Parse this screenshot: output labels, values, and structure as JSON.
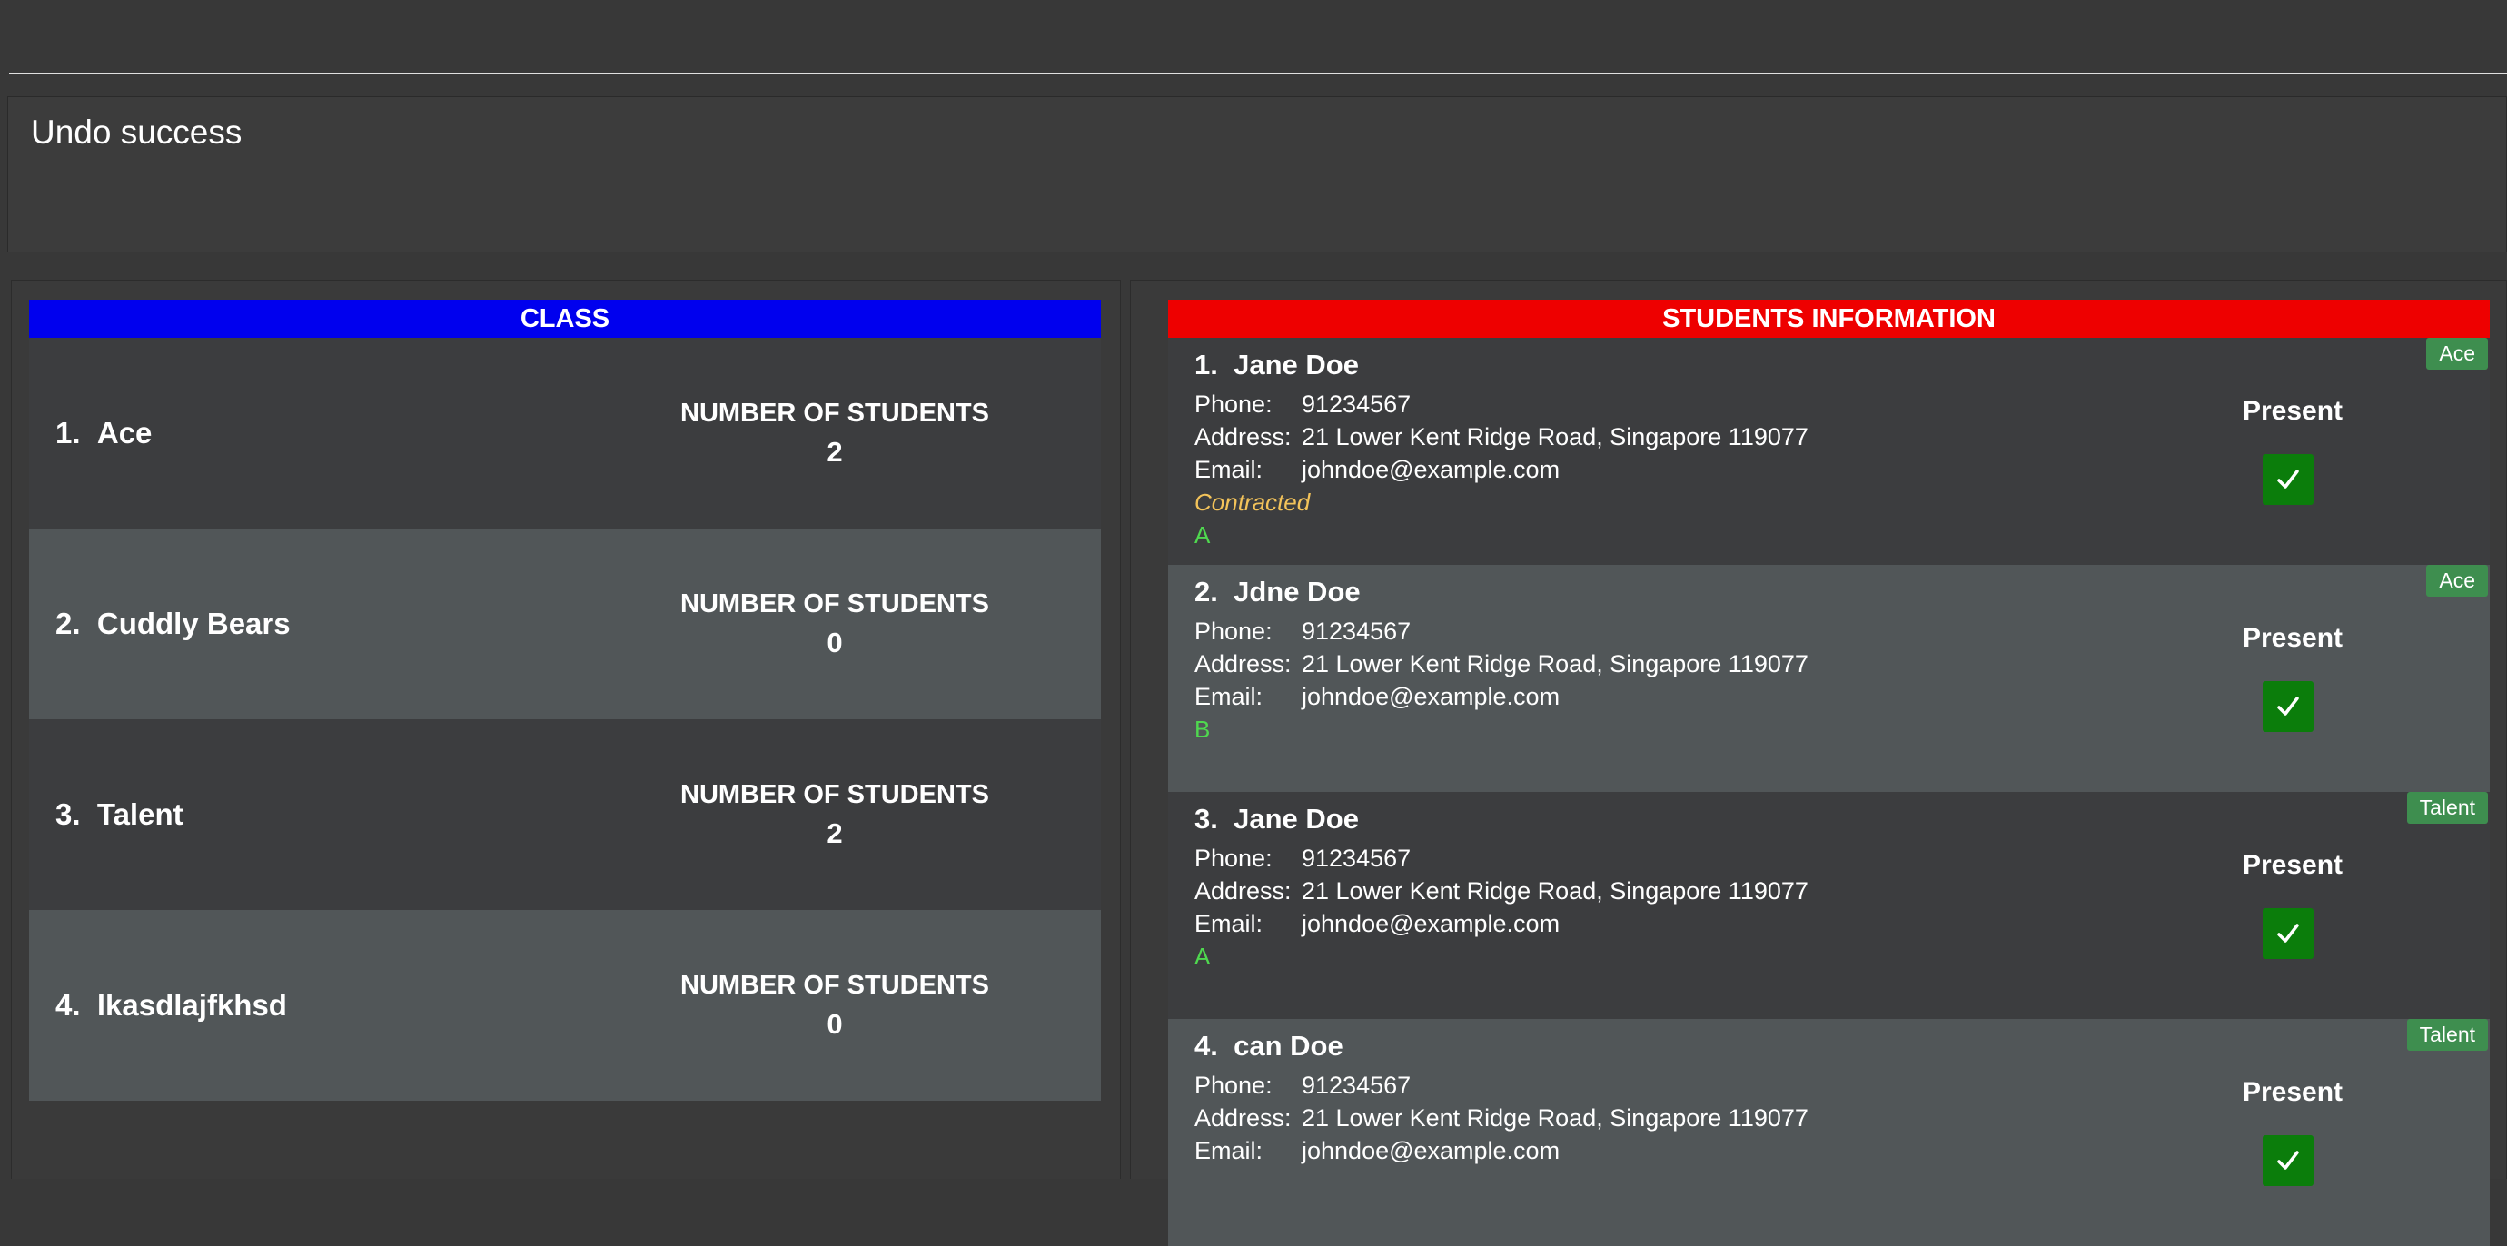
{
  "result": {
    "text": "Undo success"
  },
  "class_panel": {
    "header": "CLASS",
    "header_color": "#0000ee",
    "count_label": "NUMBER OF STUDENTS",
    "classes": [
      {
        "index": "1.",
        "name": "Ace",
        "count": "2"
      },
      {
        "index": "2.",
        "name": "Cuddly Bears",
        "count": "0"
      },
      {
        "index": "3.",
        "name": "Talent",
        "count": "2"
      },
      {
        "index": "4.",
        "name": "lkasdlajfkhsd",
        "count": "0"
      }
    ]
  },
  "student_panel": {
    "header": "STUDENTS INFORMATION",
    "header_color": "#ee0000",
    "phone_label": "Phone:",
    "address_label": "Address:",
    "email_label": "Email:",
    "present_label": "Present",
    "students": [
      {
        "index": "1.",
        "name": "Jane Doe",
        "phone": "91234567",
        "address": "21 Lower Kent Ridge Road, Singapore 119077",
        "email": "johndoe@example.com",
        "contract": "Contracted",
        "grade": "A",
        "class_tag": "Ace",
        "present": true
      },
      {
        "index": "2.",
        "name": "Jdne Doe",
        "phone": "91234567",
        "address": "21 Lower Kent Ridge Road, Singapore 119077",
        "email": "johndoe@example.com",
        "contract": "",
        "grade": "B",
        "class_tag": "Ace",
        "present": true
      },
      {
        "index": "3.",
        "name": "Jane Doe",
        "phone": "91234567",
        "address": "21 Lower Kent Ridge Road, Singapore 119077",
        "email": "johndoe@example.com",
        "contract": "",
        "grade": "A",
        "class_tag": "Talent",
        "present": true
      },
      {
        "index": "4.",
        "name": "can Doe",
        "phone": "91234567",
        "address": "21 Lower Kent Ridge Road, Singapore 119077",
        "email": "johndoe@example.com",
        "contract": "",
        "grade": "",
        "class_tag": "Talent",
        "present": true
      }
    ]
  },
  "icons": {
    "checkbox": "checkmark-icon"
  }
}
